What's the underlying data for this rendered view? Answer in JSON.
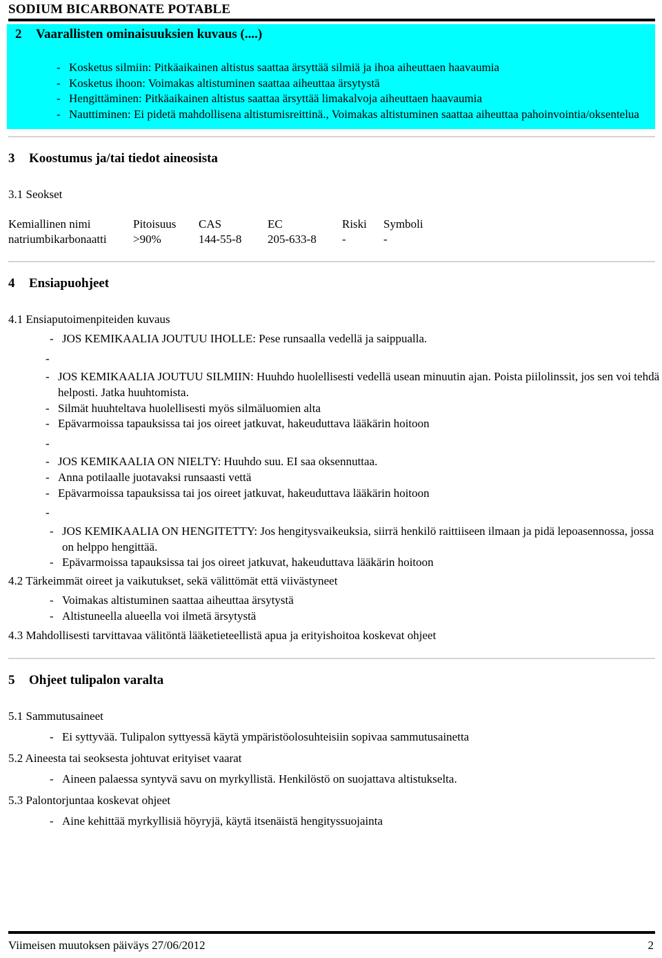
{
  "document": {
    "running_header_title": "SODIUM BICARBONATE POTABLE",
    "highlight_color": "#00ffff",
    "footer": {
      "revision_label": "Viimeisen muutoksen päiväys  27/06/2012",
      "page_number": "2"
    }
  },
  "section2": {
    "number": "2",
    "title": "Vaarallisten ominaisuuksien kuvaus (....)",
    "bullets": [
      "Kosketus silmiin: Pitkäaikainen altistus saattaa ärsyttää silmiä ja ihoa aiheuttaen haavaumia",
      "Kosketus ihoon: Voimakas altistuminen saattaa aiheuttaa ärsytystä",
      "Hengittäminen: Pitkäaikainen altistus saattaa ärsyttää limakalvoja aiheuttaen haavaumia",
      "Nauttiminen: Ei pidetä mahdollisena altistumisreittinä., Voimakas altistuminen saattaa aiheuttaa pahoinvointia/oksentelua"
    ]
  },
  "section3": {
    "number": "3",
    "title": "Koostumus ja/tai tiedot aineosista",
    "subheading": "3.1 Seokset",
    "table": {
      "headers": [
        "Kemiallinen nimi",
        "Pitoisuus",
        "CAS",
        "EC",
        "Riski",
        "Symboli"
      ],
      "rows": [
        [
          "natriumbikarbonaatti",
          ">90%",
          "144-55-8",
          "205-633-8",
          "-",
          "-"
        ]
      ]
    }
  },
  "section4": {
    "number": "4",
    "title": "Ensiapuohjeet",
    "sub41": {
      "heading": "4.1 Ensiaputoimenpiteiden kuvaus",
      "bullets": [
        "JOS KEMIKAALIA JOUTUU IHOLLE: Pese runsaalla vedellä ja saippualla.",
        "",
        "JOS KEMIKAALIA JOUTUU SILMIIN: Huuhdo huolellisesti vedellä usean minuutin ajan. Poista piilolinssit, jos sen voi tehdä helposti. Jatka huuhtomista.",
        "Silmät huuhteltava huolellisesti myös silmäluomien alta",
        "Epävarmoissa tapauksissa tai jos oireet jatkuvat, hakeuduttava lääkärin hoitoon",
        "",
        "JOS KEMIKAALIA ON NIELTY: Huuhdo suu. EI saa oksennuttaa.",
        "Anna potilaalle juotavaksi runsaasti vettä",
        "Epävarmoissa tapauksissa tai jos oireet jatkuvat, hakeuduttava lääkärin hoitoon",
        "",
        "JOS KEMIKAALIA ON HENGITETTY: Jos hengitysvaikeuksia, siirrä henkilö raittiiseen ilmaan ja pidä lepoasennossa, jossa on helppo hengittää.",
        "Epävarmoissa tapauksissa tai jos oireet jatkuvat, hakeuduttava lääkärin hoitoon"
      ]
    },
    "sub42": {
      "heading": "4.2 Tärkeimmät oireet ja vaikutukset, sekä välittömät että viivästyneet",
      "bullets": [
        "Voimakas altistuminen saattaa aiheuttaa ärsytystä",
        "Altistuneella alueella voi ilmetä ärsytystä"
      ]
    },
    "sub43": {
      "heading": "4.3 Mahdollisesti tarvittavaa välitöntä lääketieteellistä apua ja erityishoitoa koskevat ohjeet"
    }
  },
  "section5": {
    "number": "5",
    "title": "Ohjeet tulipalon varalta",
    "sub51": {
      "heading": "5.1 Sammutusaineet",
      "bullets": [
        "Ei syttyvää. Tulipalon syttyessä käytä ympäristöolosuhteisiin sopivaa sammutusainetta"
      ]
    },
    "sub52": {
      "heading": "5.2 Aineesta tai seoksesta johtuvat erityiset vaarat",
      "bullets": [
        "Aineen palaessa syntyvä savu on myrkyllistä. Henkilöstö on suojattava altistukselta."
      ]
    },
    "sub53": {
      "heading": "5.3 Palontorjuntaa koskevat ohjeet",
      "bullets": [
        "Aine kehittää myrkyllisiä höyryjä, käytä itsenäistä hengityssuojainta"
      ]
    }
  },
  "symbols": {
    "dash": "-"
  }
}
